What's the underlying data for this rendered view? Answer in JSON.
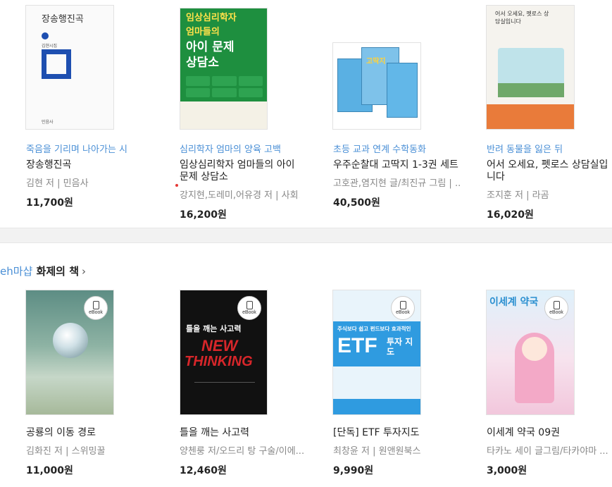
{
  "top_row": [
    {
      "kicker": "죽음을 기리며 나아가는 시",
      "title": "장송행진곡",
      "author": "김현 저 | 민음사",
      "price": "11,700원",
      "cover_text": "장송행진곡",
      "cover_sub": "김현시집",
      "cover_publisher": "민음사"
    },
    {
      "kicker": "심리학자 엄마의 양육 고백",
      "title": "임상심리학자 엄마들의 아이 문제 상담소",
      "author": "강지현,도레미,어유경 저 | 사회...",
      "price": "16,200원",
      "cover_line1": "임상심리학자",
      "cover_line2": "엄마들의",
      "cover_line3": "아이 문제",
      "cover_line4": "상담소"
    },
    {
      "kicker": "초등 교과 연계 수학동화",
      "title": "우주순찰대 고딱지 1-3권 세트",
      "author": "고호관,염지현 글/최진규 그림 | ...",
      "price": "40,500원",
      "cover_text": "고딱지"
    },
    {
      "kicker": "반려 동물을 잃은 뒤",
      "title": "어서 오세요, 펫로스 상담실입니다",
      "author": "조지훈 저 | 라곰",
      "price": "16,020원",
      "cover_text": "어서 오세요, 펫로스 상담실입니다"
    }
  ],
  "section": {
    "brand": "eh마샵",
    "title": "화제의 책",
    "chevron": "›"
  },
  "ebook_label": "eBook",
  "bottom_row": [
    {
      "title": "공룡의 이동 경로",
      "author": "김화진 저 | 스위밍꿀",
      "price": "11,000원"
    },
    {
      "title": "틀을 깨는 사고력",
      "author": "양첸룽 저/오드리 탕 구술/이에...",
      "price": "12,460원",
      "cover_small": "틀을 깨는 사고력",
      "cover_big1": "NEW",
      "cover_big2": "THINKING"
    },
    {
      "title": "[단독] ETF 투자지도",
      "author": "최창윤 저 | 원앤원북스",
      "price": "9,990원",
      "cover_top": "주식보다 쉽고 펀드보다 효과적인",
      "cover_etf": "ETF",
      "cover_side": "투자 지도"
    },
    {
      "title": "이세계 약국 09권",
      "author": "타카노 세이 글그림/타카야마 ...",
      "price": "3,000원",
      "cover_text": "이세계 약국"
    }
  ],
  "colors": {
    "kicker": "#4a8fd6",
    "price": "#222222"
  }
}
